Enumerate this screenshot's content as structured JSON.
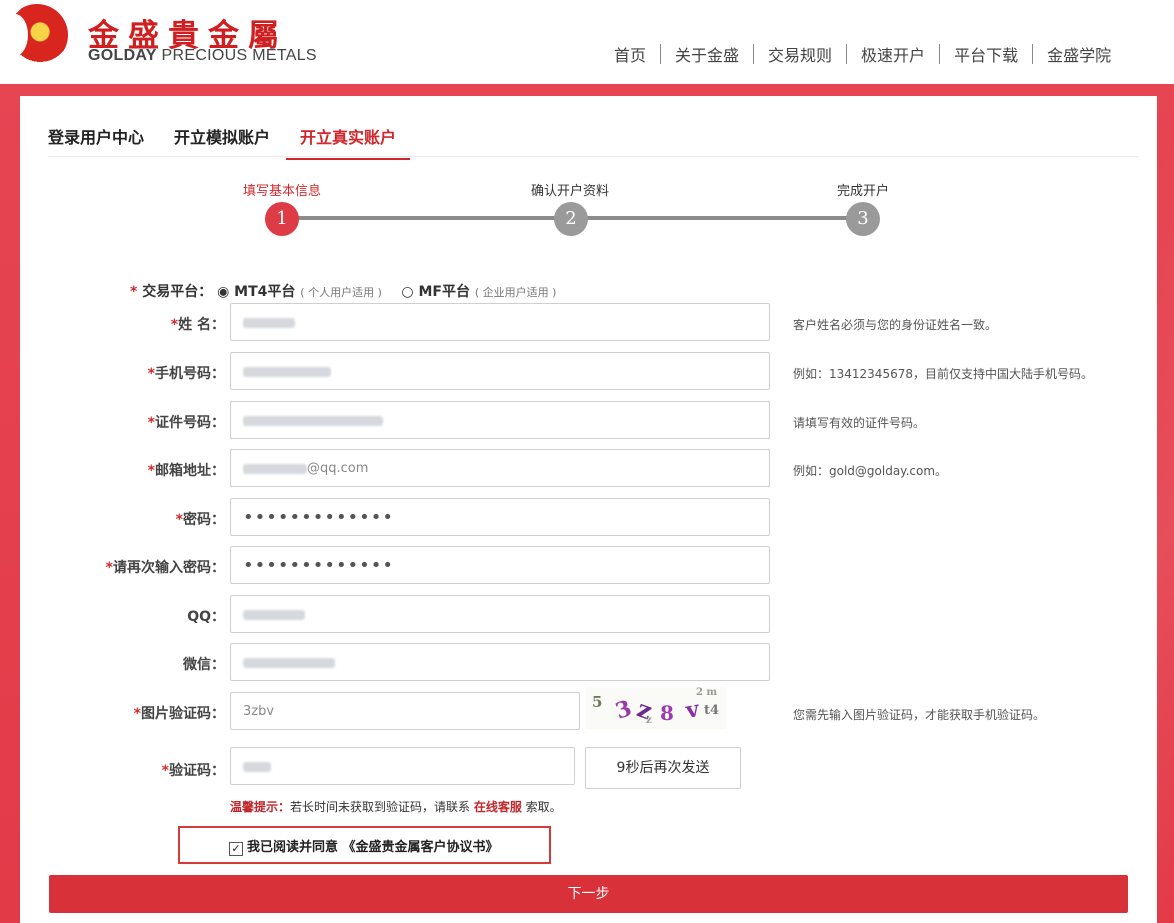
{
  "header": {
    "logo_cn": "金盛貴金屬",
    "logo_en_bold": "GOLDAY",
    "logo_en_rest": " PRECIOUS METALS",
    "nav": [
      "首页",
      "关于金盛",
      "交易规则",
      "极速开户",
      "平台下载",
      "金盛学院"
    ]
  },
  "tabs": [
    "登录用户中心",
    "开立模拟账户",
    "开立真实账户"
  ],
  "active_tab": "开立真实账户",
  "steps": [
    {
      "label": "填写基本信息",
      "num": "1",
      "state": "active"
    },
    {
      "label": "确认开户资料",
      "num": "2",
      "state": "pending"
    },
    {
      "label": "完成开户",
      "num": "3",
      "state": "pending"
    }
  ],
  "platform": {
    "label": "交易平台：",
    "options": [
      {
        "name": "MT4平台",
        "note": "( 个人用户适用 )",
        "selected": true
      },
      {
        "name": "MF平台",
        "note": "( 企业用户适用 )",
        "selected": false
      }
    ]
  },
  "form": {
    "name": {
      "label": "姓 名：",
      "hint": "客户姓名必须与您的身份证姓名一致。"
    },
    "phone": {
      "label": "手机号码：",
      "hint": "例如：13412345678，目前仅支持中国大陆手机号码。"
    },
    "id_number": {
      "label": "证件号码：",
      "hint": "请填写有效的证件号码。"
    },
    "email": {
      "label": "邮箱地址：",
      "value_suffix": "@qq.com",
      "hint": "例如：gold@golday.com。"
    },
    "password": {
      "label": "密码：",
      "value": "•••••••••••••"
    },
    "password_confirm": {
      "label": "请再次输入密码：",
      "value": "•••••••••••••"
    },
    "qq": {
      "label": "QQ："
    },
    "wechat": {
      "label": "微信："
    },
    "captcha": {
      "label": "图片验证码：",
      "value": "3zbv",
      "hint": "您需先输入图片验证码，才能获取手机验证码。"
    },
    "sms_code": {
      "label": "验证码：",
      "resend": "9秒后再次发送"
    }
  },
  "tip": {
    "prefix": "温馨提示：",
    "text": "若长时间未获取到验证码，请联系 ",
    "link": "在线客服",
    "suffix": " 索取。"
  },
  "agreement": {
    "checked": true,
    "text": "我已阅读并同意 《金盛贵金属客户协议书》"
  },
  "next_button": "下一步",
  "colors": {
    "brand_red": "#d9313a",
    "band_red": "#e43f4c"
  }
}
